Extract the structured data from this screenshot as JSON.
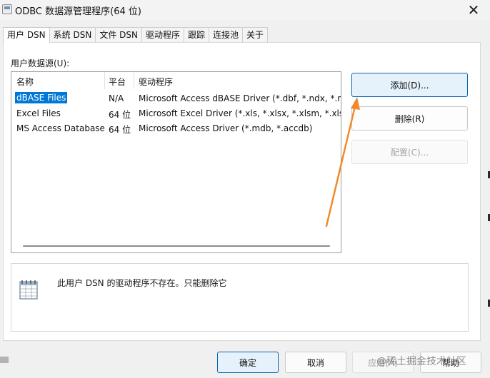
{
  "window": {
    "title": "ODBC 数据源管理程序(64 位)",
    "close_glyph": "✕",
    "icon": "odbc-app-icon"
  },
  "tabs": [
    {
      "label": "用户 DSN",
      "active": true
    },
    {
      "label": "系统 DSN"
    },
    {
      "label": "文件 DSN"
    },
    {
      "label": "驱动程序"
    },
    {
      "label": "跟踪"
    },
    {
      "label": "连接池"
    },
    {
      "label": "关于"
    }
  ],
  "user_dsn": {
    "section_label": "用户数据源(U):",
    "columns": [
      "名称",
      "平台",
      "驱动程序"
    ],
    "rows": [
      {
        "name": "dBASE Files",
        "platform": "N/A",
        "driver": "Microsoft Access dBASE Driver (*.dbf, *.ndx, *.mdx)",
        "selected": true
      },
      {
        "name": "Excel Files",
        "platform": "64 位",
        "driver": "Microsoft Excel Driver (*.xls, *.xlsx, *.xlsm, *.xlsb)"
      },
      {
        "name": "MS Access Database",
        "platform": "64 位",
        "driver": "Microsoft Access Driver (*.mdb, *.accdb)"
      }
    ]
  },
  "side_buttons": {
    "add": "添加(D)...",
    "remove": "删除(R)",
    "configure": "配置(C)..."
  },
  "info": {
    "text": "此用户 DSN 的驱动程序不存在。只能删除它",
    "icon": "data-source-table-icon"
  },
  "bottom_buttons": {
    "ok": "确定",
    "cancel": "取消",
    "apply": "应用(A)",
    "help": "帮助"
  },
  "watermark": "@稀土掘金技术社区",
  "annotation": {
    "color": "#f28a2c"
  }
}
